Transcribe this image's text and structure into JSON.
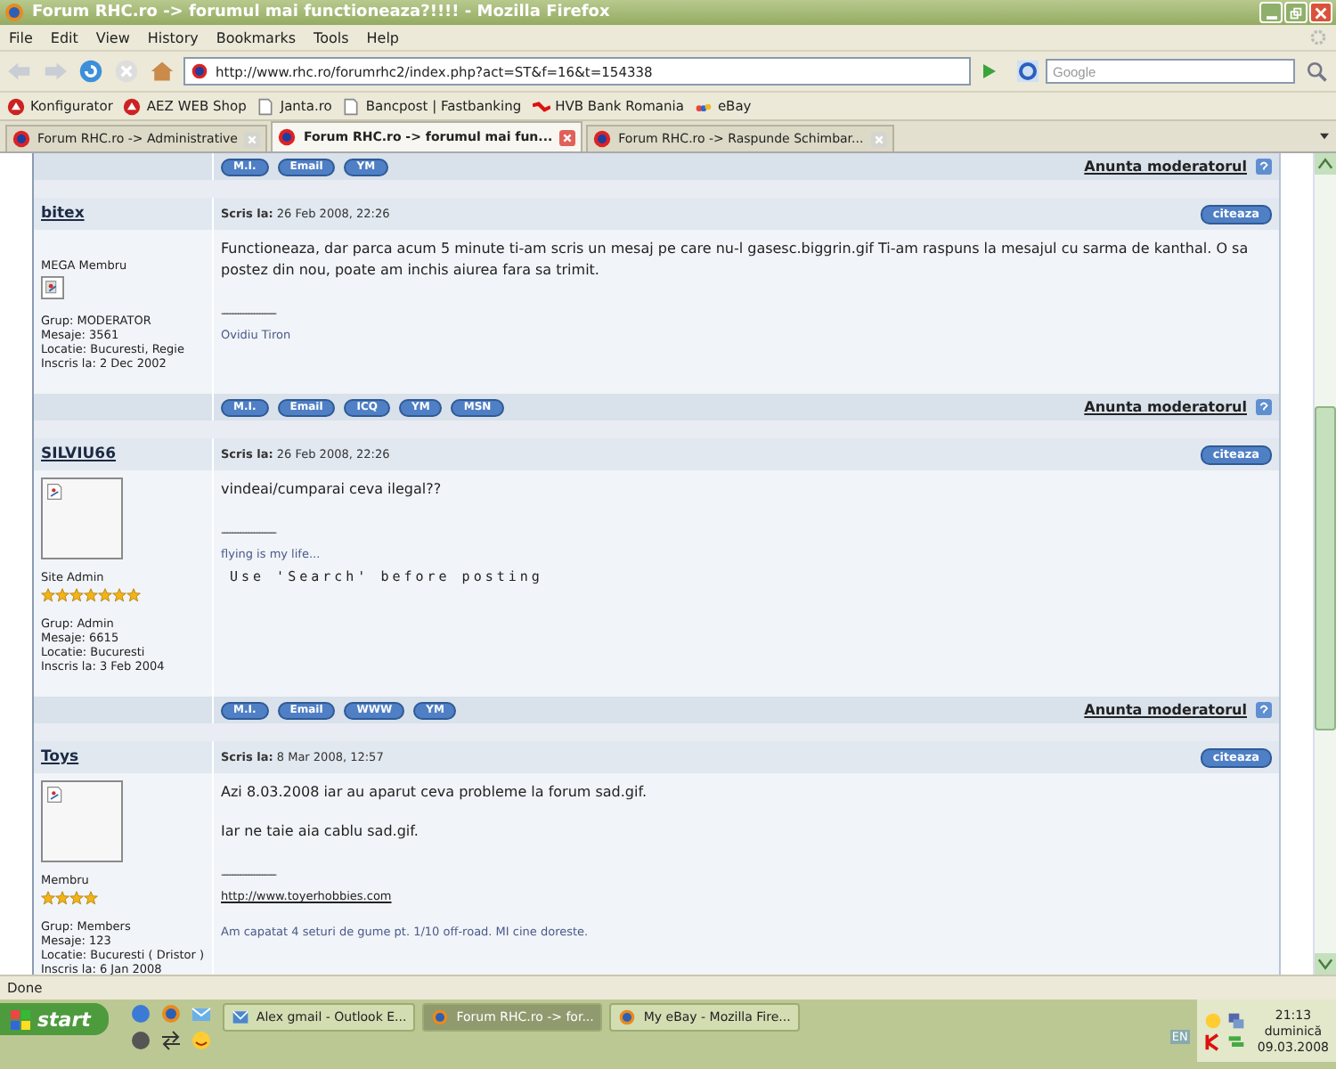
{
  "window": {
    "title": "Forum RHC.ro -> forumul mai functioneaza?!!!! - Mozilla Firefox"
  },
  "menu": [
    "File",
    "Edit",
    "View",
    "History",
    "Bookmarks",
    "Tools",
    "Help"
  ],
  "address": {
    "value": "http://www.rhc.ro/forumrhc2/index.php?act=ST&f=16&t=154338"
  },
  "search": {
    "placeholder": "Google"
  },
  "bookmarks": [
    "Konfigurator",
    "AEZ WEB Shop",
    "Janta.ro",
    "Bancpost | Fastbanking",
    "HVB Bank Romania",
    "eBay"
  ],
  "tabs": [
    {
      "label": "Forum RHC.ro -> Administrative",
      "selected": false
    },
    {
      "label": "Forum RHC.ro -> forumul mai fun...",
      "selected": true
    },
    {
      "label": "Forum RHC.ro -> Raspunde Schimbar...",
      "selected": false
    }
  ],
  "top_bar": {
    "buttons": [
      "M.I.",
      "Email",
      "YM"
    ],
    "report": "Anunta moderatorul"
  },
  "posts": [
    {
      "author": "bitex",
      "posted": "Scris la:",
      "date": "26 Feb 2008, 22:26",
      "quote": "citeaza",
      "rank": "MEGA Membru",
      "info": [
        "Grup: MODERATOR",
        "Mesaje: 3561",
        "Locatie: Bucuresti, Regie",
        "Inscris la: 2 Dec 2002"
      ],
      "message": [
        "Functioneaza, dar parca acum 5 minute ti-am scris un mesaj pe care nu-l gasesc.biggrin.gif Ti-am raspuns la mesajul cu sarma de kanthal. O sa postez din nou, poate am inchis aiurea fara sa trimit."
      ],
      "separator": "--------------------",
      "signature": [
        {
          "kind": "small",
          "text": "Ovidiu Tiron"
        }
      ],
      "buttons": [
        "M.I.",
        "Email",
        "ICQ",
        "YM",
        "MSN"
      ],
      "report": "Anunta moderatorul"
    },
    {
      "author": "SILVIU66",
      "posted": "Scris la:",
      "date": "26 Feb 2008, 22:26",
      "quote": "citeaza",
      "rank": "Site Admin",
      "stars": 7,
      "info": [
        "Grup: Admin",
        "Mesaje: 6615",
        "Locatie: Bucuresti",
        "Inscris la: 3 Feb 2004"
      ],
      "message": [
        "vindeai/cumparai ceva ilegal??"
      ],
      "separator": "--------------------",
      "signature": [
        {
          "kind": "small",
          "text": "flying is my life..."
        },
        {
          "kind": "mono",
          "text": "Use 'Search' before posting"
        }
      ],
      "buttons": [
        "M.I.",
        "Email",
        "WWW",
        "YM"
      ],
      "report": "Anunta moderatorul"
    },
    {
      "author": "Toys",
      "posted": "Scris la:",
      "date": "8 Mar 2008, 12:57",
      "quote": "citeaza",
      "rank": "Membru",
      "stars": 4,
      "info": [
        "Grup: Members",
        "Mesaje: 123",
        "Locatie: Bucuresti ( Dristor )",
        "Inscris la: 6 Jan 2008"
      ],
      "message": [
        "Azi 8.03.2008 iar au aparut ceva probleme la forum sad.gif.",
        "Iar ne taie aia cablu sad.gif."
      ],
      "separator": "--------------------",
      "signature": [
        {
          "kind": "link",
          "text": "http://www.toyerhobbies.com"
        },
        {
          "kind": "small",
          "text": "Am capatat 4 seturi de gume pt. 1/10 off-road. MI cine doreste."
        }
      ]
    }
  ],
  "status_bar": {
    "text": "Done"
  },
  "taskbar": {
    "start": "start",
    "tasks": [
      {
        "label": "Alex gmail - Outlook E...",
        "selected": false
      },
      {
        "label": "Forum RHC.ro -> for...",
        "selected": true
      },
      {
        "label": "My eBay - Mozilla Fire...",
        "selected": false
      }
    ],
    "language": "EN",
    "time": "21:13",
    "day": "duminică",
    "date": "09.03.2008"
  }
}
